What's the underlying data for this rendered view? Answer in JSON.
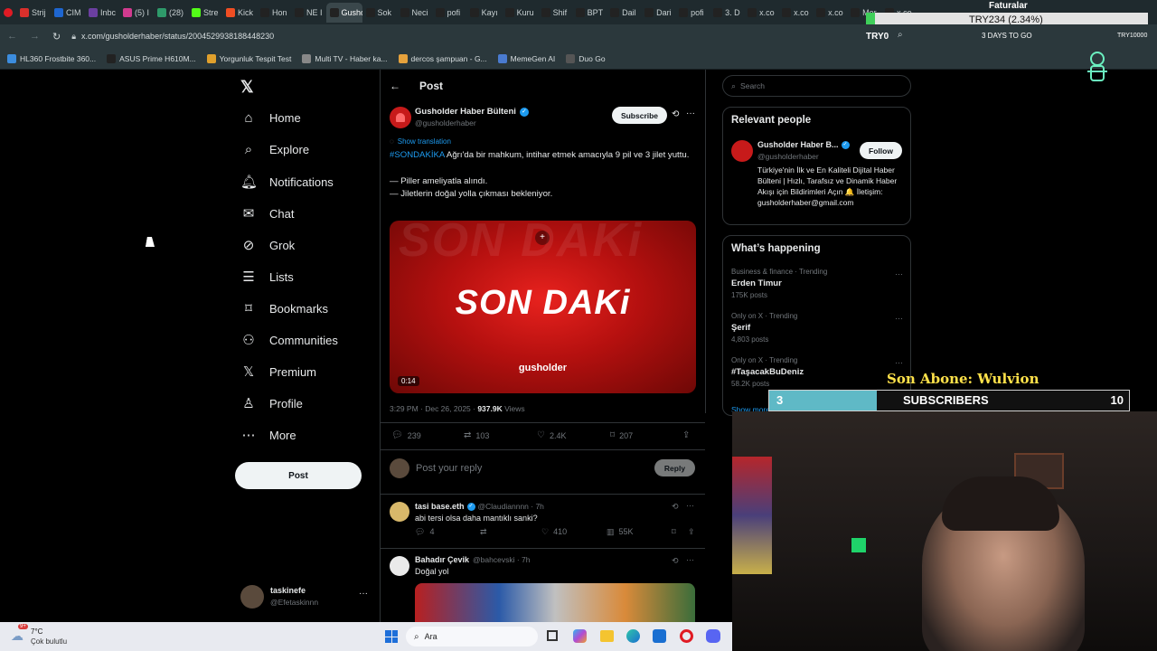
{
  "browser": {
    "tabs": [
      {
        "label": "Strij",
        "color": "#d9302c"
      },
      {
        "label": "CIM",
        "color": "#1e66d0"
      },
      {
        "label": "Inbc",
        "color": "#6b3fa0"
      },
      {
        "label": "(5) I",
        "color": "#d13b8f"
      },
      {
        "label": "(28)",
        "color": "#2e9a6a"
      },
      {
        "label": "Stre",
        "color": "#53fc18"
      },
      {
        "label": "Kick",
        "color": "#f04e23"
      },
      {
        "label": "Hon",
        "color": "#222222"
      },
      {
        "label": "NE I",
        "color": "#222222"
      },
      {
        "label": "Gushol",
        "color": "#222222"
      },
      {
        "label": "Sok",
        "color": "#222222"
      },
      {
        "label": "Neci",
        "color": "#222222"
      },
      {
        "label": "pofi",
        "color": "#222222"
      },
      {
        "label": "Kayı",
        "color": "#222222"
      },
      {
        "label": "Kuru",
        "color": "#222222"
      },
      {
        "label": "Shif",
        "color": "#222222"
      },
      {
        "label": "BPT",
        "color": "#222222"
      },
      {
        "label": "Dail",
        "color": "#222222"
      },
      {
        "label": "Dari",
        "color": "#222222"
      },
      {
        "label": "pofi",
        "color": "#222222"
      },
      {
        "label": "3. D",
        "color": "#222222"
      },
      {
        "label": "x.co",
        "color": "#222222"
      },
      {
        "label": "x.co",
        "color": "#222222"
      },
      {
        "label": "x.co",
        "color": "#222222"
      },
      {
        "label": "Mer",
        "color": "#222222"
      },
      {
        "label": "x.co",
        "color": "#222222"
      }
    ],
    "active_tab_index": 9,
    "url": "x.com/gusholderhaber/status/2004529938188448230",
    "extension_label": "TRY0",
    "days_label": "3 DAYS TO GO",
    "right_label": "TRY10000",
    "bookmarks": [
      {
        "label": "HL360 Frostbite 360...",
        "color": "#3c8dde"
      },
      {
        "label": "ASUS Prime H610M...",
        "color": "#222222"
      },
      {
        "label": "Yorgunluk Tespit Test",
        "color": "#e0a02c"
      },
      {
        "label": "Multi TV - Haber ka...",
        "color": "#888888"
      },
      {
        "label": "dercos şampuan - G...",
        "color": "#e6a23c"
      },
      {
        "label": "MemeGen AI",
        "color": "#4a7bd0"
      },
      {
        "label": "Duo Go",
        "color": "#555555"
      }
    ]
  },
  "overlay": {
    "faturalar": "Faturalar",
    "ticker": "TRY234 (2.34%)",
    "sub_label": "Son Abone: Wulvion",
    "sub_count": "3",
    "sub_title": "SUBSCRIBERS",
    "sub_goal": "10"
  },
  "sidebar": {
    "items": [
      {
        "label": "Home",
        "icon": "house-icon"
      },
      {
        "label": "Explore",
        "icon": "search-icon"
      },
      {
        "label": "Notifications",
        "icon": "bell-icon"
      },
      {
        "label": "Chat",
        "icon": "mail-icon"
      },
      {
        "label": "Grok",
        "icon": "grok-icon"
      },
      {
        "label": "Lists",
        "icon": "list-icon"
      },
      {
        "label": "Bookmarks",
        "icon": "bookmark-icon"
      },
      {
        "label": "Communities",
        "icon": "people-icon"
      },
      {
        "label": "Premium",
        "icon": "x-icon"
      },
      {
        "label": "Profile",
        "icon": "person-icon"
      },
      {
        "label": "More",
        "icon": "more-circle-icon"
      }
    ],
    "post_button": "Post",
    "account_name": "taskinefe",
    "account_handle": "@Efetaskinnn"
  },
  "post": {
    "header_title": "Post",
    "author_name": "Gusholder Haber Bülteni",
    "author_handle": "@gusholderhaber",
    "subscribe": "Subscribe",
    "show_translation": "Show translation",
    "hashtag": "#SONDAKİKA",
    "text_line1": " Ağrı'da bir mahkum, intihar etmek amacıyla 9 pil ve 3 jilet yuttu.",
    "text_line2": "— Piller ameliyatla alındı.",
    "text_line3": "— Jiletlerin doğal yolla çıkması bekleniyor.",
    "media_title": "SON DAKi",
    "media_brand": "gusholder",
    "media_duration": "0:14",
    "timestamp": "3:29 PM · Dec 26, 2025 · ",
    "views_count": "937.9K",
    "views_label": " Views",
    "replies": "239",
    "reposts": "103",
    "likes": "2.4K",
    "bookmarks": "207",
    "reply_placeholder": "Post your reply",
    "reply_button": "Reply"
  },
  "replies": [
    {
      "name": "tasi base.eth",
      "handle": "@Claudiannnn · 7h",
      "text": "abi tersi olsa daha mantıklı sanki?",
      "replies": "4",
      "reposts": "",
      "likes": "410",
      "views": "55K"
    },
    {
      "name": "Bahadır Çevik",
      "handle": "@bahcevski · 7h",
      "text": "Doğal yol"
    }
  ],
  "right": {
    "search_placeholder": "Search",
    "relevant_title": "Relevant people",
    "person_name": "Gusholder Haber B...",
    "person_handle": "@gusholderhaber",
    "follow": "Follow",
    "bio": "Türkiye'nin İlk ve En Kaliteli Dijital Haber Bülteni | Hızlı, Tarafsız ve Dinamik Haber Akışı için Bildirimleri Açın 🔔 İletişim: gusholderhaber@gmail.com",
    "happening_title": "What’s happening",
    "trends": [
      {
        "meta": "Business & finance · Trending",
        "name": "Erden Timur",
        "count": "175K posts"
      },
      {
        "meta": "Only on X · Trending",
        "name": "Şerif",
        "count": "4,803 posts"
      },
      {
        "meta": "Only on X · Trending",
        "name": "#TaşacakBuDeniz",
        "count": "58.2K posts"
      }
    ],
    "show_more": "Show more"
  },
  "taskbar": {
    "temp": "7°C",
    "weather": "Çok bulutlu",
    "search": "Ara",
    "weather_badge": "9+"
  }
}
